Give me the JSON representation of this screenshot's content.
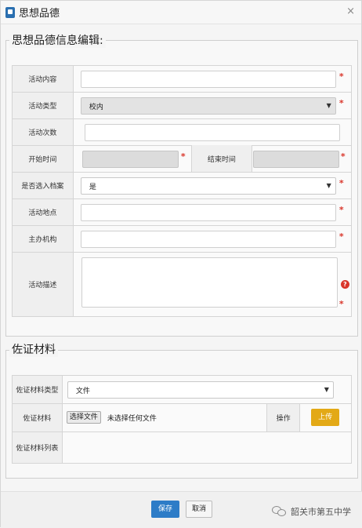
{
  "window": {
    "title": "思想品德",
    "close_glyph": "×"
  },
  "section_info": {
    "legend": "思想品德信息编辑:",
    "rows": {
      "activity_content": {
        "label": "活动内容",
        "value": ""
      },
      "activity_type": {
        "label": "活动类型",
        "selected": "校内"
      },
      "activity_count": {
        "label": "活动次数",
        "value": ""
      },
      "start_time": {
        "label": "开始时间",
        "value": ""
      },
      "end_time": {
        "label": "结束时间",
        "value": ""
      },
      "archive": {
        "label": "是否选入档案",
        "selected": "是"
      },
      "location": {
        "label": "活动地点",
        "value": ""
      },
      "organizer": {
        "label": "主办机构",
        "value": ""
      },
      "description": {
        "label": "活动描述",
        "value": ""
      }
    },
    "required_mark": "*",
    "help_glyph": "?"
  },
  "section_material": {
    "legend": "佐证材料",
    "type_label": "佐证材料类型",
    "type_selected": "文件",
    "material_label": "佐证材料",
    "choose_file_button": "选择文件",
    "file_status": "未选择任何文件",
    "operation_label": "操作",
    "upload_button": "上传",
    "list_label": "佐证材料列表"
  },
  "footer": {
    "save_button": "保存",
    "cancel_button": "取消",
    "watermark_text": "韶关市第五中学"
  },
  "colors": {
    "required": "#d9362b",
    "save": "#2d7cc7",
    "upload": "#e3a916"
  },
  "icons": {
    "caret": "▼"
  }
}
